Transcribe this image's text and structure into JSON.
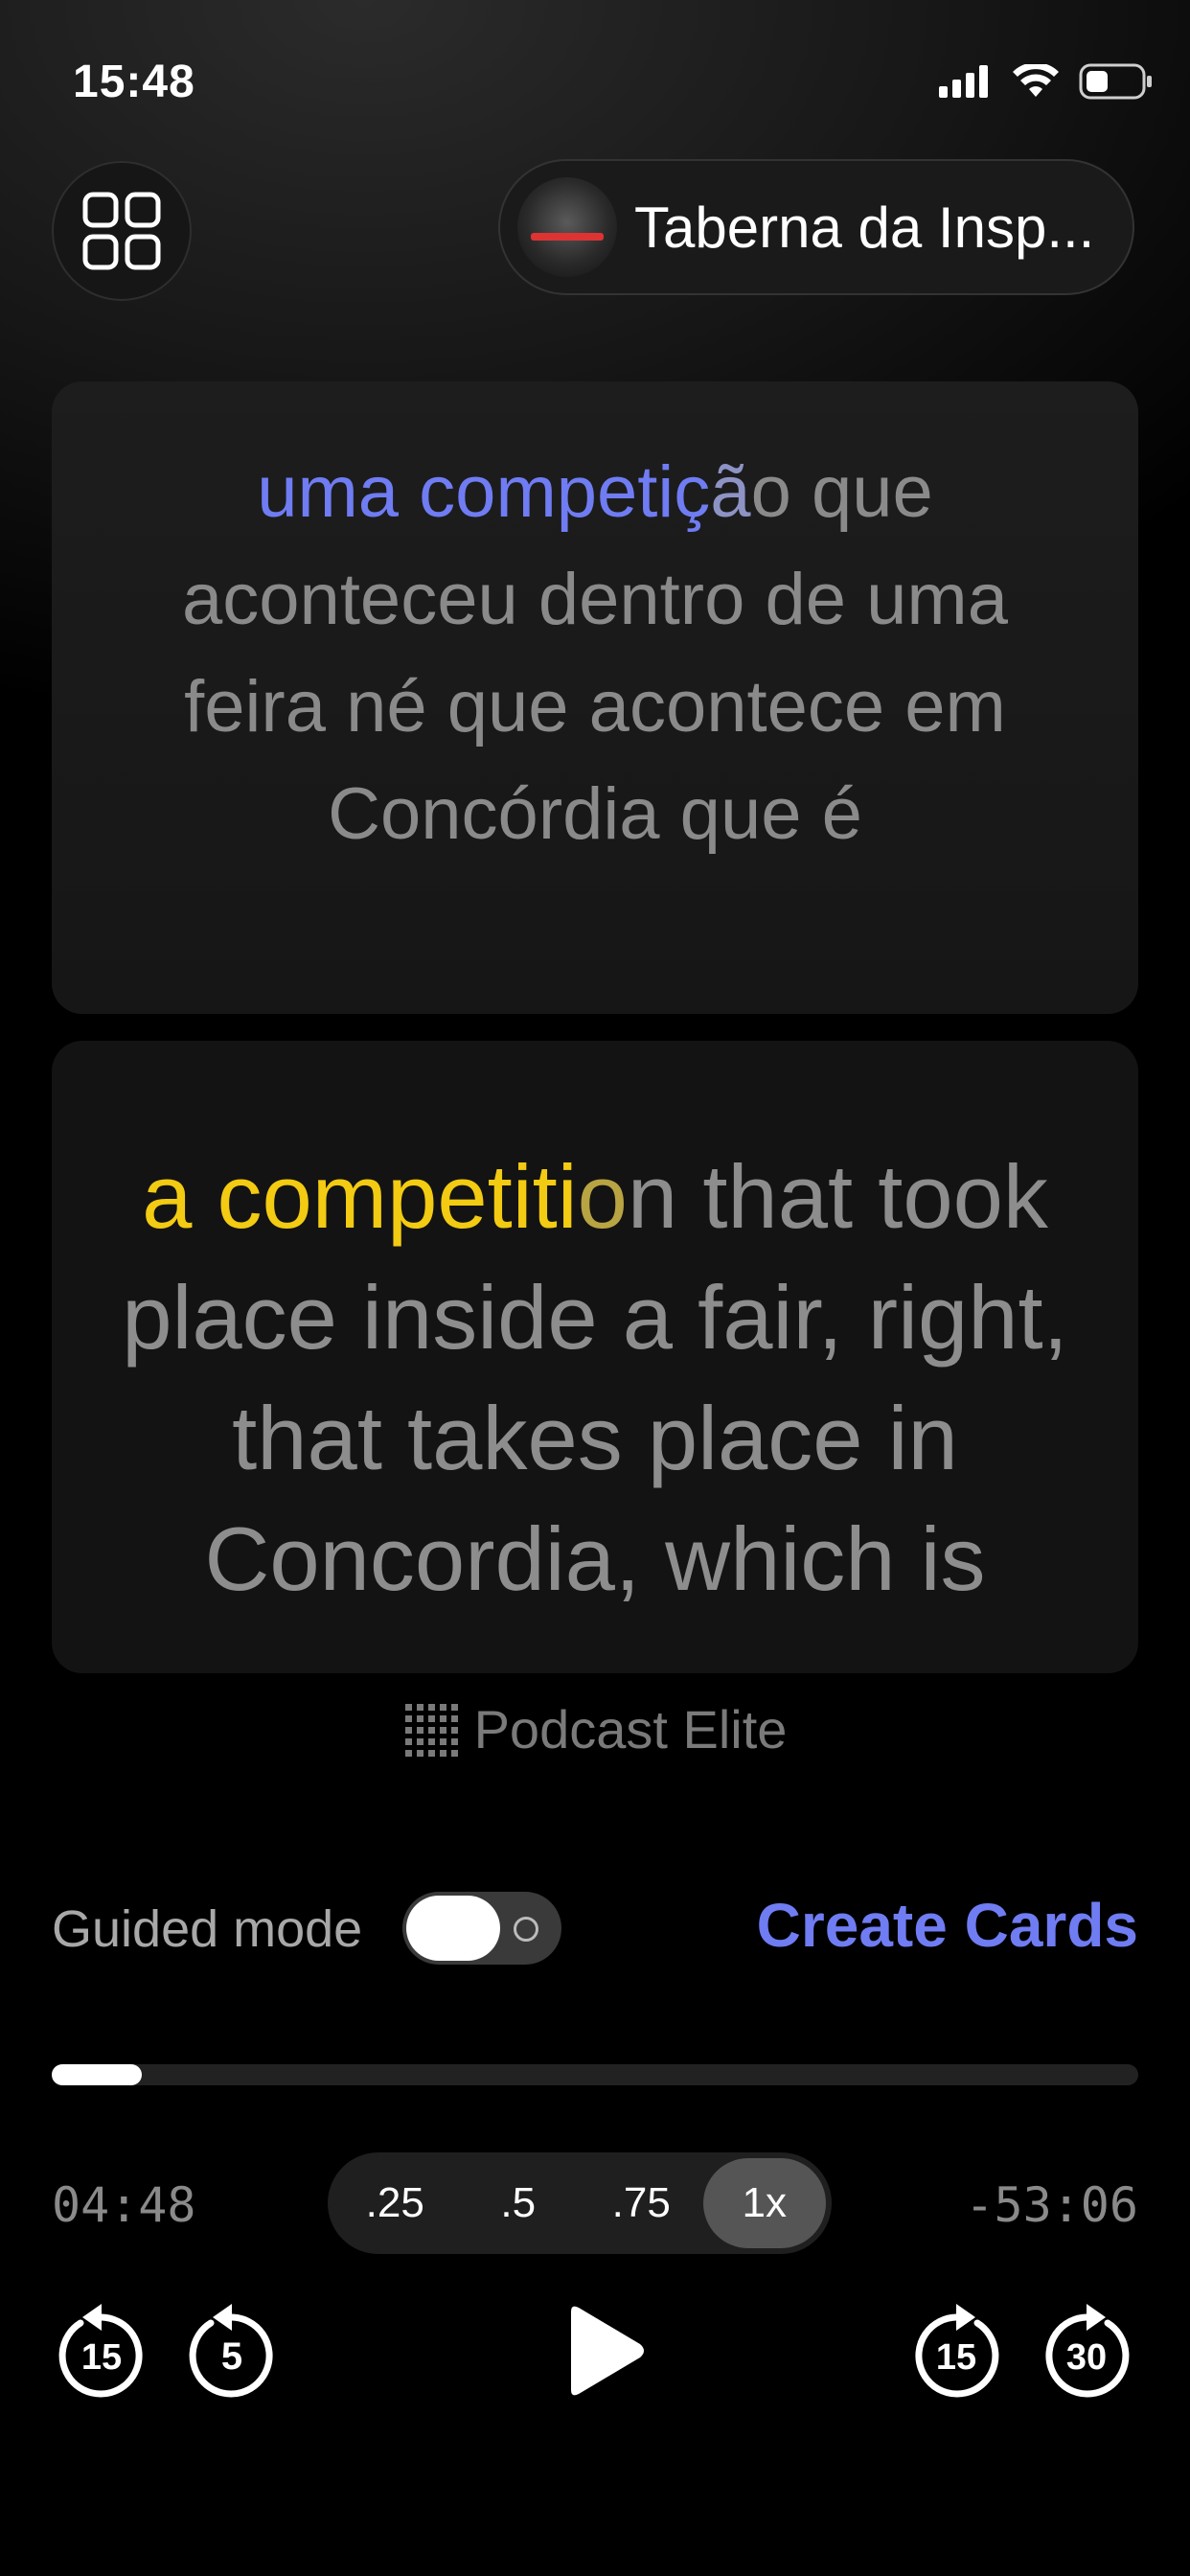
{
  "status_bar": {
    "time": "15:48"
  },
  "header": {
    "grid_icon": "grid-icon",
    "channel_name": "Taberna da Insp..."
  },
  "transcript": {
    "original": {
      "spoken": "uma competiç",
      "spoken_fade": "ã",
      "rest": "o que aconteceu dentro de uma feira né que acontece em Concórdia que é"
    },
    "translation": {
      "spoken": "a competiti",
      "spoken_fade": "o",
      "rest": "n that took place inside a fair, right, that takes place in Concordia, which is"
    }
  },
  "brand": {
    "icon": "dot-grid-icon",
    "label": "Podcast Elite"
  },
  "guided_mode": {
    "label": "Guided mode",
    "enabled": true
  },
  "create_cards_label": "Create Cards",
  "playback": {
    "progress_fraction": 0.083,
    "elapsed": "04:48",
    "remaining": "-53:06",
    "speeds": [
      ".25",
      ".5",
      ".75",
      "1x"
    ],
    "selected_speed": "1x",
    "skip_back_large": "15",
    "skip_back_small": "5",
    "skip_forward_small": "15",
    "skip_forward_large": "30"
  },
  "colors": {
    "accent_blue": "#6f7cf2",
    "accent_yellow": "#f2cb12"
  }
}
